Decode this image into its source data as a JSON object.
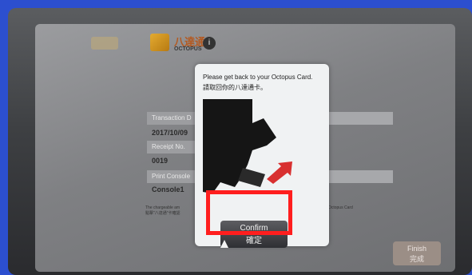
{
  "branding": {
    "octopus_cn": "八達通",
    "octopus_en": "OCTOPUS",
    "info_symbol": "i"
  },
  "receipt": {
    "transaction_label": "Transaction D",
    "transaction_value": "2017/10/09",
    "receipt_label": "Receipt No.",
    "receipt_value": "0019",
    "console_label": "Print Console",
    "console_value": "Console1",
    "note_left": "The chargeable am",
    "note_left_2": "點擊\"八達通\"卡確認",
    "note_right": "on Octopus Card"
  },
  "finish_button": {
    "label_en": "Finish",
    "label_zh": "完成"
  },
  "dialog": {
    "message_en": "Please get back to your Octopus Card.",
    "message_zh": "請取回你的八達通卡。",
    "confirm_en": "Confirm",
    "confirm_zh": "確定"
  },
  "colors": {
    "highlight": "#ff1e1e",
    "page_background": "#2c4fcf"
  }
}
